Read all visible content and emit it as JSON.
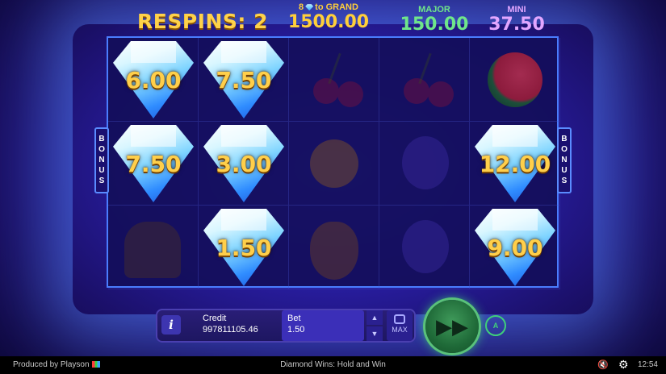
{
  "header": {
    "respins_label": "RESPINS: 2",
    "grand": {
      "prefix": "8",
      "suffix": "to GRAND",
      "value": "1500.00"
    },
    "major": {
      "label": "MAJOR",
      "value": "150.00"
    },
    "mini": {
      "label": "MINI",
      "value": "37.50"
    }
  },
  "grid": {
    "rows": [
      [
        {
          "type": "diamond",
          "value": "6.00"
        },
        {
          "type": "diamond",
          "value": "7.50"
        },
        {
          "type": "cherry"
        },
        {
          "type": "cherry"
        },
        {
          "type": "watermelon"
        }
      ],
      [
        {
          "type": "diamond",
          "value": "7.50"
        },
        {
          "type": "diamond",
          "value": "3.00"
        },
        {
          "type": "lemon"
        },
        {
          "type": "plum"
        },
        {
          "type": "diamond",
          "value": "12.00"
        }
      ],
      [
        {
          "type": "bell"
        },
        {
          "type": "diamond",
          "value": "1.50"
        },
        {
          "type": "pear"
        },
        {
          "type": "plum"
        },
        {
          "type": "diamond",
          "value": "9.00"
        }
      ]
    ]
  },
  "bonus_label": "BONUS",
  "panel": {
    "info_label": "i",
    "credit_label": "Credit",
    "credit_value": "997811105.46",
    "bet_label": "Bet",
    "bet_value": "1.50",
    "max_label": "MAX",
    "auto_label": "A"
  },
  "footer": {
    "produced": "Produced by Playson",
    "game_title": "Diamond Wins: Hold and Win",
    "time": "12:54"
  },
  "colors": {
    "gold": "#ffcf4a",
    "major_green": "#6fe68a",
    "mini_purple": "#e2a6ff",
    "grid_border": "#4a7dff"
  }
}
